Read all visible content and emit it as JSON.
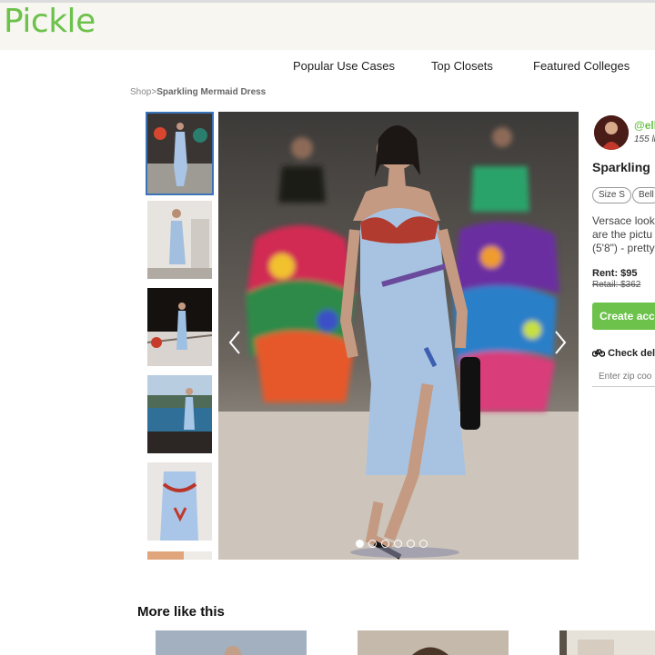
{
  "brand": {
    "logo_text": "Pickle",
    "accent_color": "#6cc24a"
  },
  "nav": {
    "items": [
      "Popular Use Cases",
      "Top Closets",
      "Featured Colleges"
    ]
  },
  "breadcrumb": {
    "root": "Shop",
    "separator": ">",
    "current": "Sparkling Mermaid Dress"
  },
  "gallery": {
    "thumb_count": 6,
    "active_index": 0,
    "dot_count": 6,
    "active_dot": 0,
    "prev_icon": "chevron-left-icon",
    "next_icon": "chevron-right-icon"
  },
  "seller": {
    "handle": "@ell",
    "listings": "155 li"
  },
  "product": {
    "title": "Sparkling",
    "tags": [
      "Size S",
      "Bell"
    ],
    "description_lines": [
      "Versace look",
      "are the pictu",
      "(5'8\") - pretty"
    ],
    "rent_label": "Rent: $95",
    "retail_label": "Retail: $362",
    "cta_label": "Create acc",
    "check_label": "Check deli",
    "zip_placeholder": "Enter zip coo"
  },
  "more": {
    "heading": "More like this"
  }
}
